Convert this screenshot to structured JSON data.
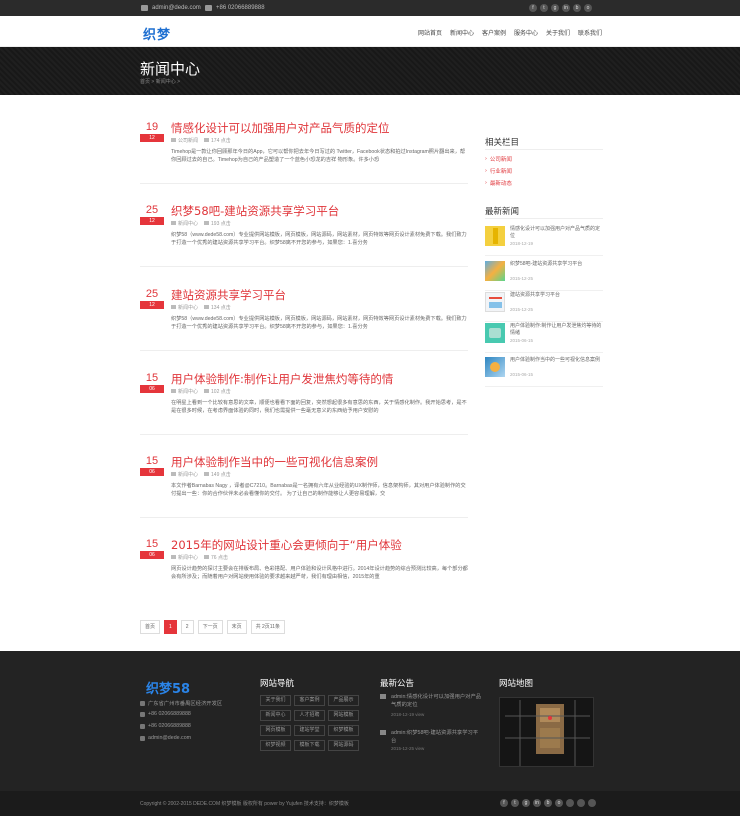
{
  "topbar": {
    "email": "admin@dede.com",
    "phone": "+86 02066889888",
    "socials": [
      "f",
      "t",
      "g",
      "in",
      "b",
      "o"
    ]
  },
  "header": {
    "logo": "织梦",
    "nav": [
      "网站首页",
      "新闻中心",
      "客户案例",
      "服务中心",
      "关于我们",
      "联系我们"
    ]
  },
  "banner": {
    "title": "新闻中心",
    "breadcrumb": "首页 > 新闻中心 >"
  },
  "articles": [
    {
      "day": "19",
      "month": "12",
      "title": "情感化设计可以加强用户对产品气质的定位",
      "category": "公司新闻",
      "views": "174 点击",
      "desc": "Timehop是一款让你回顾那年今日的App，它可以帮你把去年今日写过的 Twitter，Facebook状态和拍过Instagram照片翻出来，帮你回顾过去的自己。Timehop为自己的产品塑造了一个蓝色小恐龙的吉祥 物形象。许多小恐"
    },
    {
      "day": "25",
      "month": "12",
      "title": "织梦58吧-建站资源共享学习平台",
      "category": "新闻中心",
      "views": "193 点击",
      "desc": "织梦58（www.dede58.com）专业提供网站模板，网页模板，网站源码，网站素材，网页特效等网页设计素材免费下载。我们致力于打造一个优秀的建站资源共享学习平台。织梦58离不开您的参与，如果您：1.喜分务"
    },
    {
      "day": "25",
      "month": "12",
      "title": "建站资源共享学习平台",
      "category": "新闻中心",
      "views": "134 点击",
      "desc": "织梦58（www.dede58.com）专业提供网站模板，网页模板，网站源码，网站素材，网页特效等网页设计素材免费下载。我们致力于打造一个优秀的建站资源共享学习平台。织梦58离不开您的参与，如果您：1.喜分务"
    },
    {
      "day": "15",
      "month": "06",
      "title": "用户体验制作:制作让用户发泄焦灼等待的情",
      "category": "新闻中心",
      "views": "102 点击",
      "desc": "在明星上看到一个比较有意思的文章，顺便也看看下面的回复，突然想起很多有意思的东西，关于情感化制作。我开始思考，是不是在很多时候，在考虑界面体验的同时，我们也需提供一些毫无意义的东西给予用户安慰的"
    },
    {
      "day": "15",
      "month": "06",
      "title": "用户体验制作当中的一些可视化信息案例",
      "category": "新闻中心",
      "views": "149 点击",
      "desc": "本文作者Barnabas Nagy ，译者@C7210。Barnabas是一名拥有六年从业经验的UX制作师，信息架构师，其对用户体验制作的交付提出一些：你的合作伙伴未必会看懂你的交付。 为了让自己的制作能够让人更容易理解，交"
    },
    {
      "day": "15",
      "month": "06",
      "title": "2015年的网站设计重心会更倾向于“用户体验",
      "category": "新闻中心",
      "views": "76 点击",
      "desc": "网页设计趋势的探讨主要会在排版布局、色彩搭配、用户体验和设计风格中进行。2014年设计趋势的综合预测比较高，每个部分都会有所涉及；而随着用户对网站使用体验的要求越来越严苛，我们有理由相信，2015年的重"
    }
  ],
  "pager": [
    "首页",
    "1",
    "2",
    "下一页",
    "末页",
    "共 2页11条"
  ],
  "sidebar": {
    "cat_title": "相关栏目",
    "categories": [
      "公司新闻",
      "行业新闻",
      "最新动态"
    ],
    "news_title": "最新新闻",
    "news": [
      {
        "title": "情感化设计可以加强用户对产品气质的定位",
        "date": "2018-12-19"
      },
      {
        "title": "织梦58吧-建站资源共享学习平台",
        "date": "2015-12-25"
      },
      {
        "title": "建站资源共享学习平台",
        "date": "2015-12-25"
      },
      {
        "title": "用户体验制作:制作让用户发泄焦灼等待的情绪",
        "date": "2015-06-15"
      },
      {
        "title": "用户体验制作当中的一些可视化信息案例",
        "date": "2015-06-15"
      }
    ]
  },
  "footer": {
    "logo": "织梦58",
    "address": "广东省广州市番禺区经济开发区",
    "phone1": "+86 02066889888",
    "phone2": "+86 02066889888",
    "email": "admin@dede.com",
    "nav_title": "网站导航",
    "nav_tags": [
      "关于我们",
      "客户案例",
      "产品展示",
      "新闻中心",
      "人才招聘",
      "网站模板",
      "网页模板",
      "建站学堂",
      "织梦模板",
      "织梦视频",
      "模板下载",
      "网站源码"
    ],
    "notice_title": "最新公告",
    "notices": [
      {
        "text": "admin:情感化设计可以加强用户对产品气质的定位",
        "date": "2018-12-19"
      },
      {
        "text": "admin:织梦58吧-建站资源共享学习平台",
        "date": "2015-12-25"
      }
    ],
    "notice_more": "view",
    "map_title": "网站地图",
    "copyright": "Copyright © 2002-2015 DEDE.COM 织梦模板 版权所有 power by Yujufen 技术支持：织梦模板"
  },
  "colors": {
    "accent": "#e5353b",
    "brand": "#1e6fd1",
    "footer_bg": "#232323"
  }
}
